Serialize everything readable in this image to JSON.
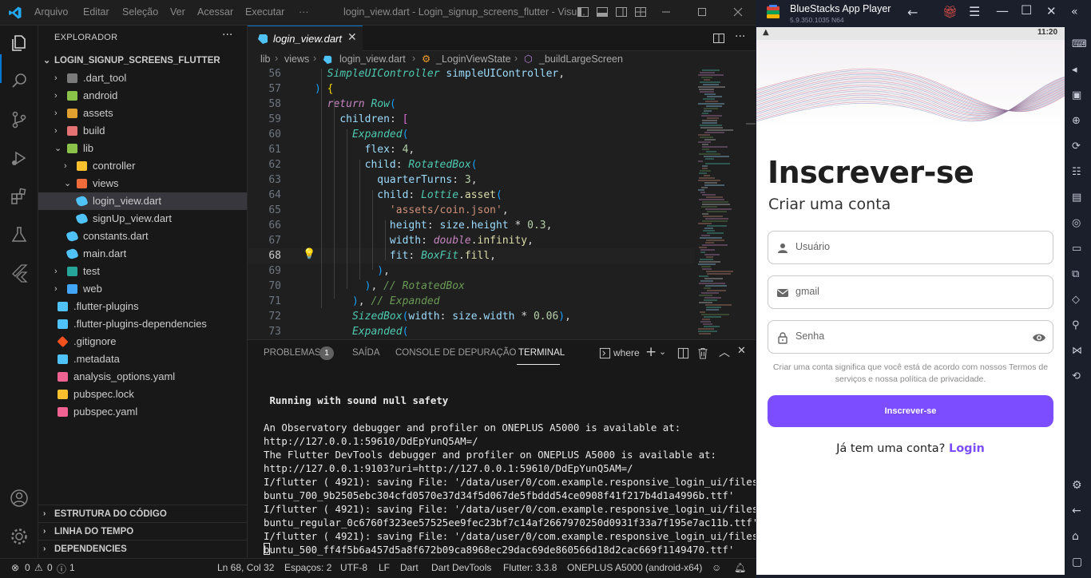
{
  "titlebar": {
    "menu": [
      "Arquivo",
      "Editar",
      "Seleção",
      "Ver",
      "Acessar",
      "Executar",
      "···"
    ],
    "title": "login_view.dart - Login_signup_screens_flutter - Visu..."
  },
  "sidebar": {
    "title": "EXPLORADOR",
    "more": "···",
    "root": "LOGIN_SIGNUP_SCREENS_FLUTTER",
    "items": [
      {
        "label": ".dart_tool",
        "icon": "folder-icon",
        "color": "#7a7a7a"
      },
      {
        "label": "android",
        "icon": "android-folder-icon",
        "color": "#8bc34a"
      },
      {
        "label": "assets",
        "icon": "folder-icon",
        "color": "#e0a030"
      },
      {
        "label": "build",
        "icon": "folder-icon",
        "color": "#e57373"
      },
      {
        "label": "lib",
        "icon": "folder-open-icon",
        "color": "#8bc34a"
      },
      {
        "label": "controller",
        "icon": "folder-icon",
        "color": "#fbc02d"
      },
      {
        "label": "views",
        "icon": "folder-open-icon",
        "color": "#ef6c3a"
      },
      {
        "label": "login_view.dart",
        "icon": "dart-icon",
        "color": "#4fc3f7"
      },
      {
        "label": "signUp_view.dart",
        "icon": "dart-icon",
        "color": "#4fc3f7"
      },
      {
        "label": "constants.dart",
        "icon": "dart-icon",
        "color": "#4fc3f7"
      },
      {
        "label": "main.dart",
        "icon": "dart-icon",
        "color": "#4fc3f7"
      },
      {
        "label": "test",
        "icon": "folder-icon",
        "color": "#26a69a"
      },
      {
        "label": "web",
        "icon": "web-folder-icon",
        "color": "#42a5f5"
      },
      {
        "label": ".flutter-plugins",
        "icon": "file-icon",
        "color": "#4fc3f7"
      },
      {
        "label": ".flutter-plugins-dependencies",
        "icon": "file-icon",
        "color": "#4fc3f7"
      },
      {
        "label": ".gitignore",
        "icon": "git-icon",
        "color": "#f4511e"
      },
      {
        "label": ".metadata",
        "icon": "file-icon",
        "color": "#4fc3f7"
      },
      {
        "label": "analysis_options.yaml",
        "icon": "yaml-icon",
        "color": "#f06292"
      },
      {
        "label": "pubspec.lock",
        "icon": "lock-icon",
        "color": "#fbc02d"
      },
      {
        "label": "pubspec.yaml",
        "icon": "yaml-icon",
        "color": "#f06292"
      }
    ],
    "sections": [
      "ESTRUTURA DO CÓDIGO",
      "LINHA DO TEMPO",
      "DEPENDENCIES"
    ]
  },
  "editor": {
    "tab_label": "login_view.dart",
    "breadcrumb": [
      "lib",
      "views",
      "login_view.dart",
      "_LoginViewState",
      "_buildLargeScreen"
    ],
    "lines": [
      {
        "n": "56",
        "code": "  SimpleUIController simpleUIController,"
      },
      {
        "n": "57",
        "code": ") {"
      },
      {
        "n": "58",
        "code": "  return Row("
      },
      {
        "n": "59",
        "code": "    children: ["
      },
      {
        "n": "60",
        "code": "      Expanded("
      },
      {
        "n": "61",
        "code": "        flex: 4,"
      },
      {
        "n": "62",
        "code": "        child: RotatedBox("
      },
      {
        "n": "63",
        "code": "          quarterTurns: 3,"
      },
      {
        "n": "64",
        "code": "          child: Lottie.asset("
      },
      {
        "n": "65",
        "code": "            'assets/coin.json',"
      },
      {
        "n": "66",
        "code": "            height: size.height * 0.3,"
      },
      {
        "n": "67",
        "code": "            width: double.infinity,"
      },
      {
        "n": "68",
        "code": "            fit: BoxFit.fill,"
      },
      {
        "n": "69",
        "code": "          ),"
      },
      {
        "n": "70",
        "code": "        ), // RotatedBox"
      },
      {
        "n": "71",
        "code": "      ), // Expanded"
      },
      {
        "n": "72",
        "code": "      SizedBox(width: size.width * 0.06),"
      },
      {
        "n": "73",
        "code": "      Expanded("
      }
    ],
    "current_line": "68"
  },
  "panel": {
    "tabs": [
      "PROBLEMAS",
      "SAÍDA",
      "CONSOLE DE DEPURAÇÃO",
      "TERMINAL"
    ],
    "problems_count": "1",
    "terminal_name": "where",
    "terminal": [
      "",
      " Running with sound null safety",
      "",
      "An Observatory debugger and profiler on ONEPLUS A5000 is available at:",
      "http://127.0.0.1:59610/DdEpYunQ5AM=/",
      "The Flutter DevTools debugger and profiler on ONEPLUS A5000 is available at:",
      "http://127.0.0.1:9103?uri=http://127.0.0.1:59610/DdEpYunQ5AM=/",
      "I/flutter ( 4921): saving File: '/data/user/0/com.example.responsive_login_ui/files/U",
      "buntu_700_9b2505ebc304cfd0570e37d34f5d067de5fbddd54ce0908f41f217b4d1a4996b.ttf'",
      "I/flutter ( 4921): saving File: '/data/user/0/com.example.responsive_login_ui/files/U",
      "buntu_regular_0c6760f323ee57525ee9fec23bf7c14af2667970250d0931f33a7f195e7ac11b.ttf'",
      "I/flutter ( 4921): saving File: '/data/user/0/com.example.responsive_login_ui/files/U",
      "buntu_500_ff4f5b6a457d5a8f672b09ca8968ec29dac69de860566d18d2cac669f1149470.ttf'"
    ]
  },
  "statusbar": {
    "errors": "0",
    "warnings": "0",
    "info": "1",
    "position": "Ln 68, Col 32",
    "spaces": "Espaços: 2",
    "encoding": "UTF-8",
    "eol": "LF",
    "language": "Dart",
    "devtools": "Dart DevTools",
    "flutter": "Flutter: 3.3.8",
    "device": "ONEPLUS A5000 (android-x64)"
  },
  "bluestacks": {
    "title": "BlueStacks App Player",
    "version": "5.9.350.1035 N64",
    "time": "11:20",
    "heading": "Inscrever-se",
    "subheading": "Criar uma conta",
    "fields": [
      {
        "placeholder": "Usuário",
        "icon": "person-icon"
      },
      {
        "placeholder": "gmail",
        "icon": "mail-icon"
      },
      {
        "placeholder": "Senha",
        "icon": "lock-icon"
      }
    ],
    "terms": "Criar uma conta significa que você está de acordo com nossos Termos de serviços e nossa política de privacidade.",
    "button": "Inscrever-se",
    "have_account": "Já tem uma conta?",
    "login": "Login",
    "accent": "#7b4dff"
  }
}
